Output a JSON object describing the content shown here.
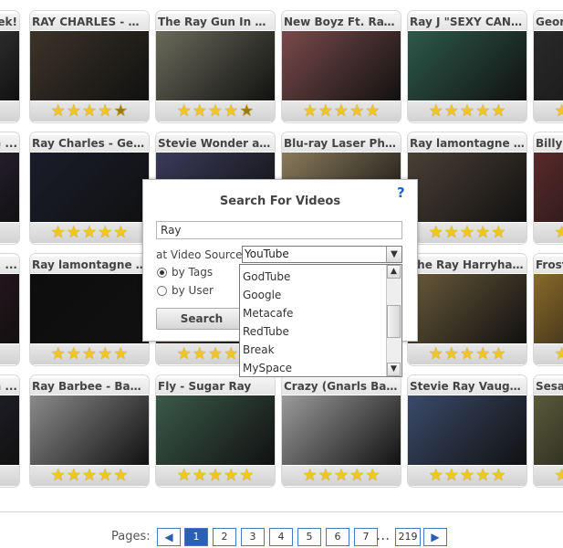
{
  "tiles": [
    {
      "title": "ek!",
      "rating": 5,
      "color": "#4a4a4a"
    },
    {
      "title": "RAY CHARLES - ME ...",
      "rating": 4.5,
      "color": "#3b3429"
    },
    {
      "title": "The Ray Gun In Acti ...",
      "rating": 4.5,
      "color": "#6a6a5a"
    },
    {
      "title": "New Boyz Ft. Ray J ...",
      "rating": 5,
      "color": "#7a4a4a"
    },
    {
      "title": "Ray J \"SEXY CAN I\" ...",
      "rating": 5,
      "color": "#2d5a4a"
    },
    {
      "title": "Georg",
      "rating": 5,
      "color": "#2a2a2a"
    },
    {
      "title": "G ...",
      "rating": 5,
      "color": "#3a2a4a"
    },
    {
      "title": "Ray Charles - Georg ...",
      "rating": 5,
      "color": "#1a1d2a"
    },
    {
      "title": "Stevie Wonder and ...",
      "rating": 5,
      "color": "#3a3a5a"
    },
    {
      "title": "Blu-ray Laser Phaser",
      "rating": 5,
      "color": "#8a7a5a"
    },
    {
      "title": "Ray lamontagne - L ...",
      "rating": 5,
      "color": "#4a4035"
    },
    {
      "title": "Billy R",
      "rating": 5,
      "color": "#5a2a2a"
    },
    {
      "title": "...",
      "rating": 5,
      "color": "#3a1a2a"
    },
    {
      "title": "Ray lamontagne - T ...",
      "rating": 5,
      "color": "#0d0d0d"
    },
    {
      "title": "",
      "rating": 5,
      "color": "#5a4a3a"
    },
    {
      "title": "",
      "rating": 5,
      "color": "#4a4a4a"
    },
    {
      "title": "The Ray Harryhaus ...",
      "rating": 5,
      "color": "#6a5a3a"
    },
    {
      "title": "Frost",
      "rating": 5,
      "color": "#8a6a2a"
    },
    {
      "title": "an ...",
      "rating": 5,
      "color": "#2a2a3a"
    },
    {
      "title": "Ray Barbee - Ban This",
      "rating": 5,
      "color": "#8a8a8a"
    },
    {
      "title": "Fly - Sugar Ray",
      "rating": 5,
      "color": "#3a5a4a"
    },
    {
      "title": "Crazy (Gnarls Barkl ...",
      "rating": 5,
      "color": "#9a9a9a"
    },
    {
      "title": "Stevie Ray Vaughan ...",
      "rating": 5,
      "color": "#3a4a6a"
    },
    {
      "title": "Sesam",
      "rating": 5,
      "color": "#5a5a3a"
    }
  ],
  "dialog": {
    "title": "Search For Videos",
    "help_icon": "question-icon",
    "search_value": "Ray",
    "source_label": "at Video Source:",
    "source_selected": "YouTube",
    "by_tags": "by Tags",
    "by_user": "by User",
    "search_button": "Search",
    "options": [
      "GodTube",
      "Google",
      "Metacafe",
      "RedTube",
      "Break",
      "MySpace"
    ]
  },
  "pager": {
    "label": "Pages:",
    "pages": [
      "1",
      "2",
      "3",
      "4",
      "5",
      "6",
      "7"
    ],
    "ellipsis": "...",
    "last": "219",
    "active": "1"
  }
}
